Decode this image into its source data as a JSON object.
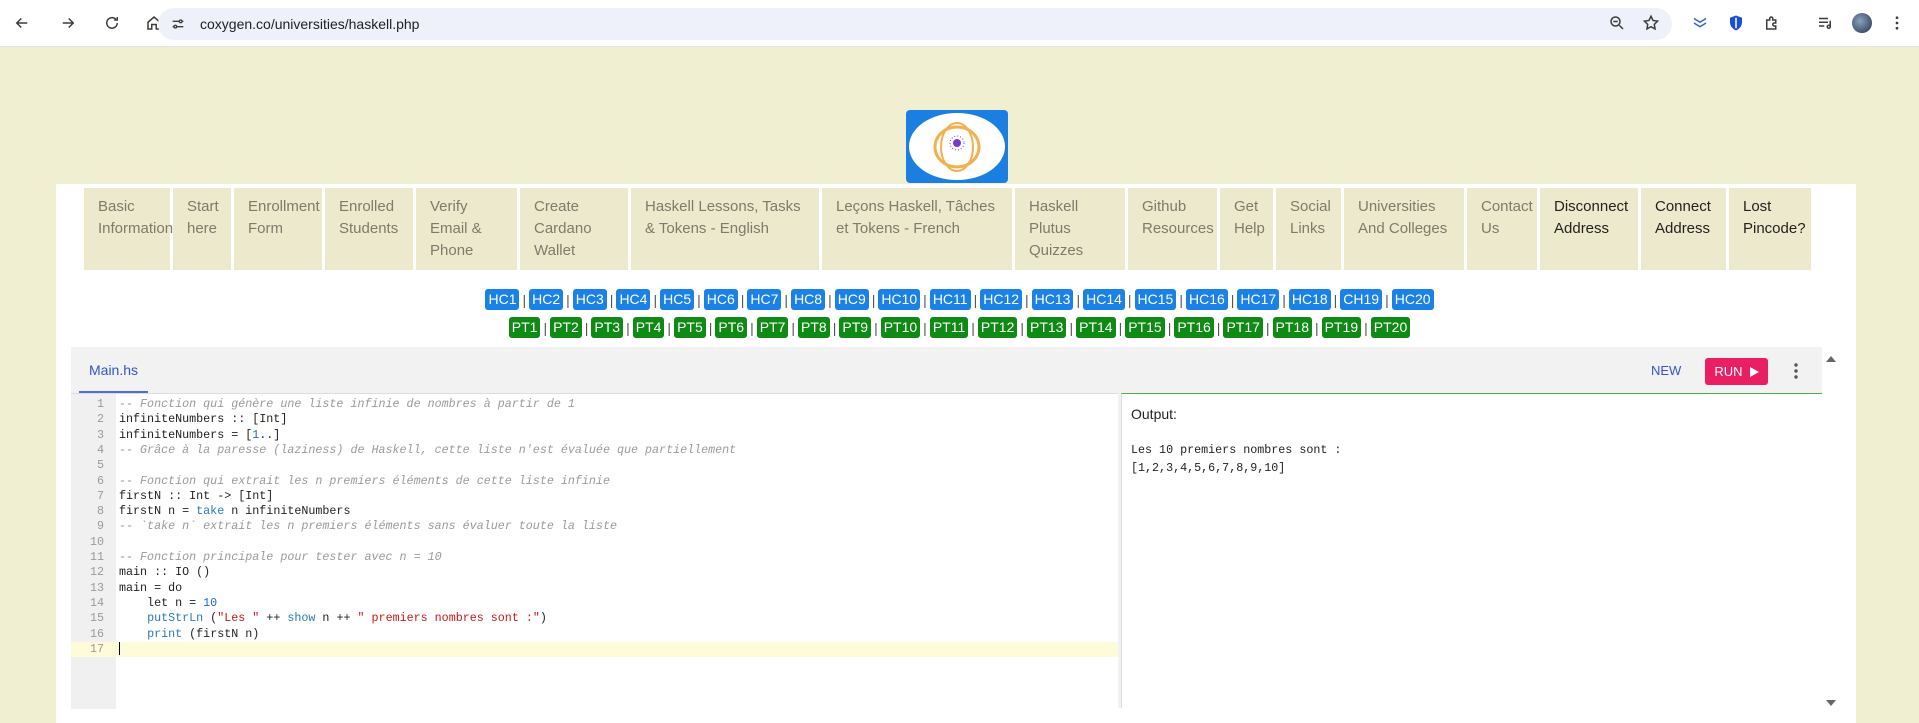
{
  "browser": {
    "url": "coxygen.co/universities/haskell.php",
    "icons": [
      "back-arrow-icon",
      "forward-arrow-icon",
      "reload-icon",
      "home-icon",
      "site-settings-icon",
      "zoom-icon",
      "bookmark-star-icon",
      "extension-icon",
      "shield-icon",
      "puzzle-icon",
      "media-icon",
      "profile-avatar",
      "menu-kebab-icon"
    ]
  },
  "menu": {
    "items": [
      {
        "label": "Basic Information",
        "width": 86,
        "dark": false
      },
      {
        "label": "Start here",
        "width": 58,
        "dark": false
      },
      {
        "label": "Enrollment Form",
        "width": 88,
        "dark": false
      },
      {
        "label": "Enrolled Students",
        "width": 88,
        "dark": false
      },
      {
        "label": "Verify Email & Phone",
        "width": 101,
        "dark": false
      },
      {
        "label": "Create Cardano Wallet",
        "width": 108,
        "dark": false
      },
      {
        "label": "Haskell Lessons, Tasks & Tokens - English",
        "width": 188,
        "dark": false
      },
      {
        "label": "Leçons Haskell, Tâches et Tokens - French",
        "width": 190,
        "dark": false
      },
      {
        "label": "Haskell Plutus Quizzes",
        "width": 110,
        "dark": false
      },
      {
        "label": "Github Resources",
        "width": 89,
        "dark": false
      },
      {
        "label": "Get Help",
        "width": 53,
        "dark": false
      },
      {
        "label": "Social Links",
        "width": 65,
        "dark": false
      },
      {
        "label": "Universities And Colleges",
        "width": 120,
        "dark": false
      },
      {
        "label": "Contact Us",
        "width": 70,
        "dark": false
      },
      {
        "label": "Disconnect Address",
        "width": 98,
        "dark": true
      },
      {
        "label": "Connect Address",
        "width": 85,
        "dark": true
      },
      {
        "label": "Lost Pincode?",
        "width": 82,
        "dark": true
      }
    ]
  },
  "hc_badges": [
    "HC1",
    "HC2",
    "HC3",
    "HC4",
    "HC5",
    "HC6",
    "HC7",
    "HC8",
    "HC9",
    "HC10",
    "HC11",
    "HC12",
    "HC13",
    "HC14",
    "HC15",
    "HC16",
    "HC17",
    "HC18",
    "CH19",
    "HC20"
  ],
  "pt_badges": [
    "PT1",
    "PT2",
    "PT3",
    "PT4",
    "PT5",
    "PT6",
    "PT7",
    "PT8",
    "PT9",
    "PT10",
    "PT11",
    "PT12",
    "PT13",
    "PT14",
    "PT15",
    "PT16",
    "PT17",
    "PT18",
    "PT19",
    "PT20"
  ],
  "badge_separator": "|",
  "editor": {
    "tab_label": "Main.hs",
    "new_label": "NEW",
    "run_label": "RUN",
    "lines": [
      [
        {
          "t": "-- Fonction qui génère une liste infinie de nombres à partir de 1",
          "c": "c-comment"
        }
      ],
      [
        {
          "t": "infiniteNumbers :: [Int]",
          "c": ""
        }
      ],
      [
        {
          "t": "infiniteNumbers = [",
          "c": ""
        },
        {
          "t": "1",
          "c": "c-num"
        },
        {
          "t": "..]",
          "c": ""
        }
      ],
      [
        {
          "t": "-- Grâce à la paresse (laziness) de Haskell, cette liste n'est évaluée que partiellement",
          "c": "c-comment"
        }
      ],
      [],
      [
        {
          "t": "-- Fonction qui extrait les n premiers éléments de cette liste infinie",
          "c": "c-comment"
        }
      ],
      [
        {
          "t": "firstN :: Int -> [Int]",
          "c": ""
        }
      ],
      [
        {
          "t": "firstN n = ",
          "c": ""
        },
        {
          "t": "take",
          "c": "c-fn"
        },
        {
          "t": " n infiniteNumbers",
          "c": ""
        }
      ],
      [
        {
          "t": "-- `take n` extrait les n premiers éléments sans évaluer toute la liste",
          "c": "c-comment"
        }
      ],
      [],
      [
        {
          "t": "-- Fonction principale pour tester avec n = 10",
          "c": "c-comment"
        }
      ],
      [
        {
          "t": "main :: IO ()",
          "c": ""
        }
      ],
      [
        {
          "t": "main = do",
          "c": ""
        }
      ],
      [
        {
          "t": "    let n = ",
          "c": ""
        },
        {
          "t": "10",
          "c": "c-num"
        }
      ],
      [
        {
          "t": "    ",
          "c": ""
        },
        {
          "t": "putStrLn",
          "c": "c-fn"
        },
        {
          "t": " (",
          "c": ""
        },
        {
          "t": "\"Les \"",
          "c": "c-str"
        },
        {
          "t": " ++ ",
          "c": ""
        },
        {
          "t": "show",
          "c": "c-fn"
        },
        {
          "t": " n ++ ",
          "c": ""
        },
        {
          "t": "\" premiers nombres sont :\"",
          "c": "c-str"
        },
        {
          "t": ")",
          "c": ""
        }
      ],
      [
        {
          "t": "    ",
          "c": ""
        },
        {
          "t": "print",
          "c": "c-fn"
        },
        {
          "t": " (firstN n)",
          "c": ""
        }
      ],
      []
    ],
    "active_line": 17
  },
  "output": {
    "label": "Output:",
    "text": "Les 10 premiers nombres sont :\n[1,2,3,4,5,6,7,8,9,10]"
  },
  "colors": {
    "page_bg": "#f1efd2",
    "menu_bg": "#ede9cc",
    "hc_badge": "#1a81e6",
    "pt_badge": "#0f8a15",
    "run_button": "#e91e63",
    "accent_blue": "#3355cc"
  }
}
